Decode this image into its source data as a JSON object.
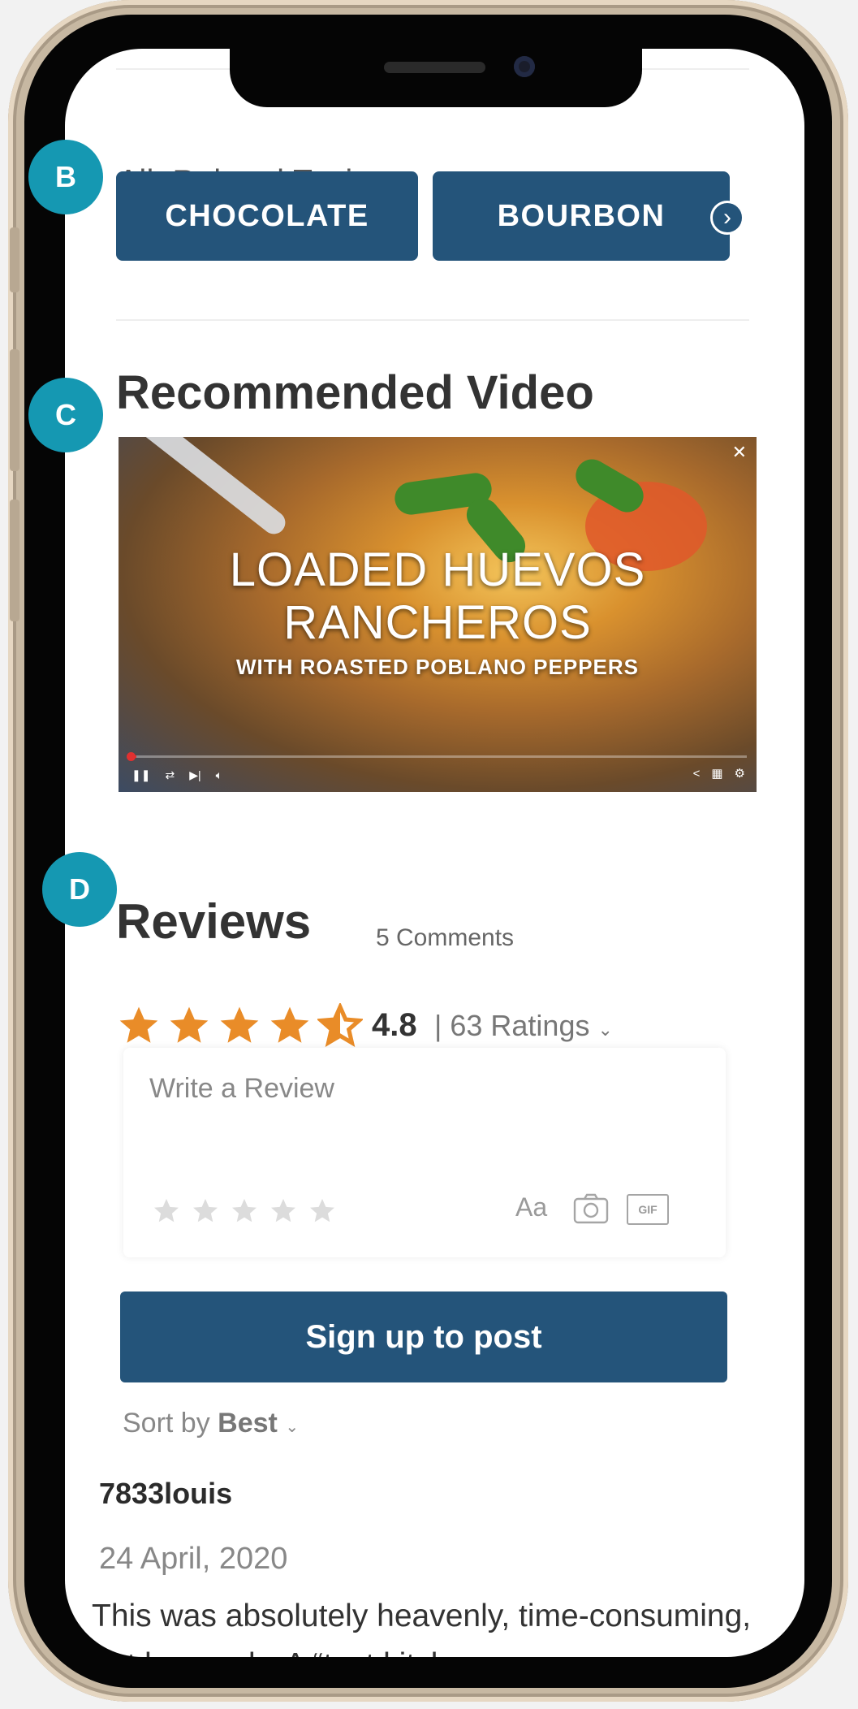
{
  "topics": {
    "header": "All  Related Topics",
    "items": [
      "CHOCOLATE",
      "BOURBON"
    ],
    "next_icon": "chevron-right-icon"
  },
  "badges": {
    "b": "B",
    "c": "C",
    "d": "D"
  },
  "video_section": {
    "title": "Recommended Video",
    "video": {
      "title_line1": "LOADED HUEVOS",
      "title_line2": "RANCHEROS",
      "subtitle": "WITH ROASTED POBLANO PEPPERS",
      "progress_fraction": 0.01
    }
  },
  "reviews": {
    "title": "Reviews",
    "comment_count": "5 Comments",
    "rating_value": "4.8",
    "ratings_label": "| 63 Ratings",
    "rating_stars": 4.5,
    "write_placeholder": "Write a Review",
    "font_tool_label": "Aa",
    "gif_label": "GIF",
    "signup_label": "Sign up to post",
    "sort_prefix": "Sort by",
    "sort_value": "Best"
  },
  "comment": {
    "username": "7833louis",
    "date": "24 April, 2020",
    "text": "This was absolutely heavenly, time-consuming, but heavenly. A “test kitchen"
  },
  "colors": {
    "primary": "#24547a",
    "badge": "#1598b2",
    "star": "#e98c28"
  }
}
